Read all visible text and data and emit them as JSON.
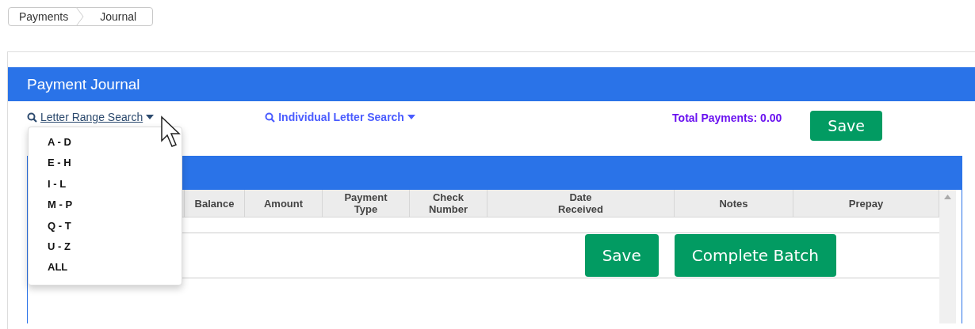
{
  "breadcrumb": [
    "Payments",
    "Journal"
  ],
  "panel": {
    "title": "Payment Journal"
  },
  "toolbar": {
    "letter_range_search": {
      "label": "Letter Range Search",
      "expanded": true
    },
    "individual_letter_search": {
      "label": "Individual Letter Search"
    },
    "total_payments": "Total Payments: 0.00",
    "save_button": "Save"
  },
  "letter_range_menu": [
    "A - D",
    "E - H",
    "I - L",
    "M - P",
    "Q - T",
    "U - Z",
    "ALL"
  ],
  "table": {
    "columns": [
      "",
      "Balance",
      "Amount",
      "Payment\nType",
      "Check\nNumber",
      "Date\nReceived",
      "Notes",
      "Prepay"
    ]
  },
  "actions": [
    "Save",
    "Complete Batch"
  ]
}
